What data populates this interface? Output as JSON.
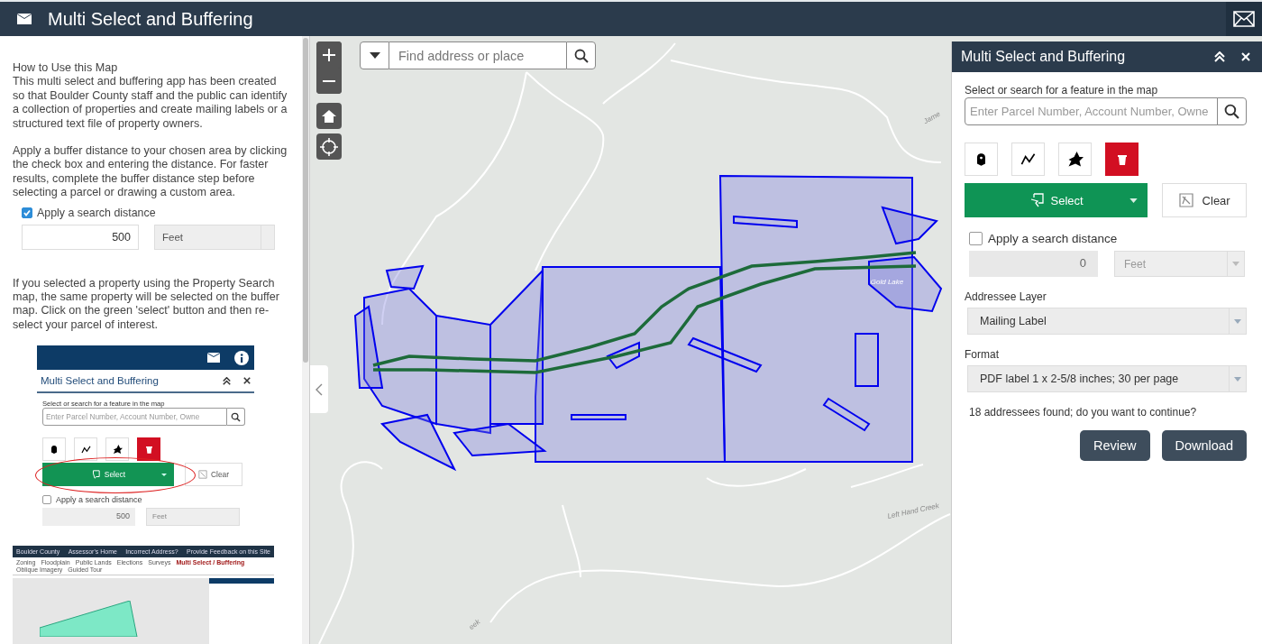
{
  "header": {
    "title": "Multi Select and Buffering"
  },
  "help": {
    "heading": "How to Use this Map",
    "intro": "This multi select and buffering app has been created so that Boulder County staff and the public can identify a collection of properties and create mailing labels or a structured text file of property owners.",
    "buffer_text": "Apply a buffer distance to your chosen area by clicking the check box and entering the distance. For faster results, complete the buffer distance step before selecting a parcel or drawing a custom area.",
    "buffer_demo": {
      "checked": true,
      "label": "Apply a search distance",
      "distance": "500",
      "unit": "Feet"
    },
    "select_text": "If you selected a property using the Property Search map, the same property will be selected on the buffer map. Click on the green 'select' button and then re-select your parcel of interest.",
    "widget_image": {
      "title": "Multi Select and Buffering",
      "search_label": "Select or search for a feature in the map",
      "search_placeholder": "Enter Parcel Number, Account Number, Owne",
      "select_label": "Select",
      "clear_label": "Clear",
      "buffer": {
        "checked": false,
        "label": "Apply a search distance",
        "distance": "500",
        "unit": "Feet"
      }
    },
    "site_image": {
      "nav_links": [
        "Boulder County",
        "Assessor's Home",
        "Incorrect Address?",
        "Provide Feedback on this Site"
      ],
      "tabs": [
        {
          "label": "Zoning",
          "selected": false
        },
        {
          "label": "Floodplain",
          "selected": false
        },
        {
          "label": "Public Lands",
          "selected": false
        },
        {
          "label": "Elections",
          "selected": false
        },
        {
          "label": "Surveys",
          "selected": false
        },
        {
          "label": "Multi Select / Buffering",
          "selected": true
        },
        {
          "label": "Oblique Imagery",
          "selected": false
        },
        {
          "label": "Guided Tour",
          "selected": false
        }
      ]
    }
  },
  "map": {
    "search_placeholder": "Find address or place",
    "labels": [
      {
        "text": "Jame",
        "kind": "road"
      },
      {
        "text": "Gold Lake",
        "kind": "lake"
      },
      {
        "text": "Left Hand Creek",
        "kind": "creek"
      },
      {
        "text": "eek",
        "kind": "creek2"
      }
    ]
  },
  "panel": {
    "title": "Multi Select and Buffering",
    "search_label": "Select or search for a feature in the map",
    "search_placeholder": "Enter Parcel Number, Account Number, Owne",
    "tools": [
      {
        "kind": "point"
      },
      {
        "kind": "line"
      },
      {
        "kind": "polygon"
      },
      {
        "kind": "delete"
      }
    ],
    "select_label": "Select",
    "clear_label": "Clear",
    "buffer": {
      "checked": false,
      "label": "Apply a search distance",
      "distance": "0",
      "unit": "Feet"
    },
    "addressee_layer": {
      "label": "Addressee Layer",
      "value": "Mailing Label"
    },
    "format": {
      "label": "Format",
      "value": "PDF label 1 x 2-5/8 inches; 30 per page"
    },
    "message": "18 addressees found; do you want to continue?",
    "buttons": [
      {
        "label": "Review"
      },
      {
        "label": "Download"
      }
    ]
  }
}
